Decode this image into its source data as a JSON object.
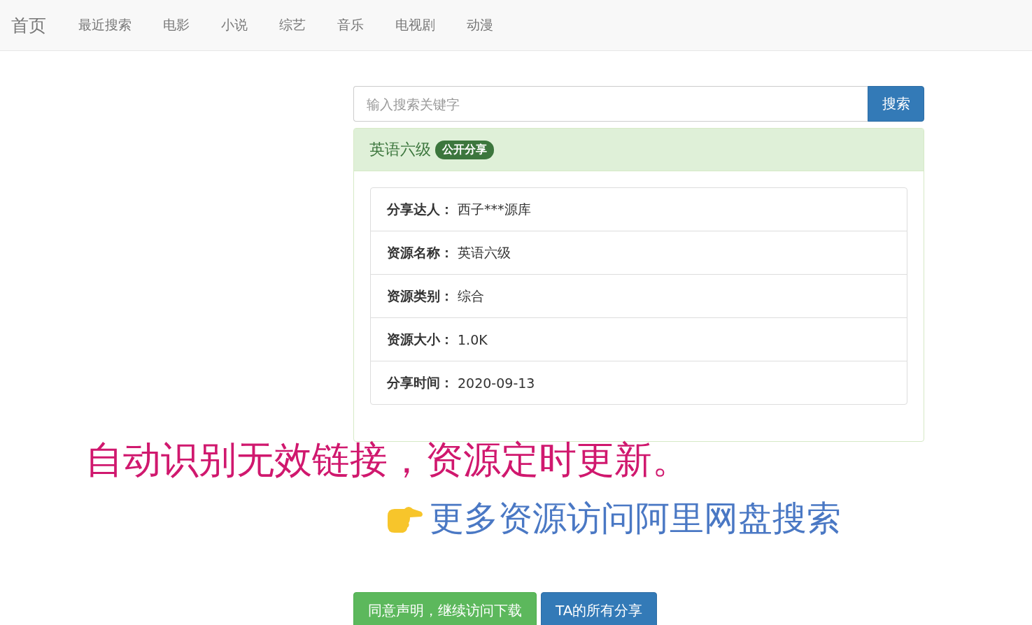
{
  "navbar": {
    "brand": "首页",
    "items": [
      "最近搜索",
      "电影",
      "小说",
      "综艺",
      "音乐",
      "电视剧",
      "动漫"
    ]
  },
  "search": {
    "placeholder": "输入搜索关键字",
    "button": "搜索"
  },
  "panel": {
    "title": "英语六级",
    "badge": "公开分享",
    "rows": [
      {
        "label": "分享达人：",
        "value": "西子***源库"
      },
      {
        "label": "资源名称：",
        "value": "英语六级"
      },
      {
        "label": "资源类别：",
        "value": "综合"
      },
      {
        "label": "资源大小：",
        "value": "1.0K"
      },
      {
        "label": "分享时间：",
        "value": "2020-09-13"
      }
    ]
  },
  "annotation": "自动识别无效链接，资源定时更新。",
  "promo": "更多资源访问阿里网盘搜索",
  "buttons": [
    {
      "label": "同意声明，继续访问下载",
      "kind": "success"
    },
    {
      "label": "TA的所有分享",
      "kind": "primary"
    }
  ]
}
